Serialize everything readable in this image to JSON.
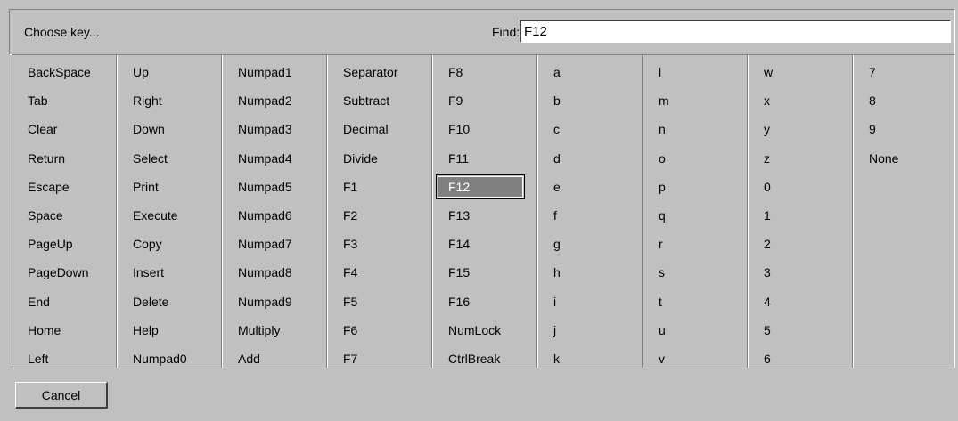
{
  "header": {
    "choose_label": "Choose key...",
    "find_label": "Find:",
    "find_value": "F12"
  },
  "columns": [
    [
      "BackSpace",
      "Tab",
      "Clear",
      "Return",
      "Escape",
      "Space",
      "PageUp",
      "PageDown",
      "End",
      "Home",
      "Left"
    ],
    [
      "Up",
      "Right",
      "Down",
      "Select",
      "Print",
      "Execute",
      "Copy",
      "Insert",
      "Delete",
      "Help",
      "Numpad0"
    ],
    [
      "Numpad1",
      "Numpad2",
      "Numpad3",
      "Numpad4",
      "Numpad5",
      "Numpad6",
      "Numpad7",
      "Numpad8",
      "Numpad9",
      "Multiply",
      "Add"
    ],
    [
      "Separator",
      "Subtract",
      "Decimal",
      "Divide",
      "F1",
      "F2",
      "F3",
      "F4",
      "F5",
      "F6",
      "F7"
    ],
    [
      "F8",
      "F9",
      "F10",
      "F11",
      "F12",
      "F13",
      "F14",
      "F15",
      "F16",
      "NumLock",
      "CtrlBreak"
    ],
    [
      "a",
      "b",
      "c",
      "d",
      "e",
      "f",
      "g",
      "h",
      "i",
      "j",
      "k"
    ],
    [
      "l",
      "m",
      "n",
      "o",
      "p",
      "q",
      "r",
      "s",
      "t",
      "u",
      "v"
    ],
    [
      "w",
      "x",
      "y",
      "z",
      "0",
      "1",
      "2",
      "3",
      "4",
      "5",
      "6"
    ],
    [
      "7",
      "8",
      "9",
      "None"
    ]
  ],
  "selected_key": "F12",
  "footer": {
    "cancel_label": "Cancel"
  }
}
